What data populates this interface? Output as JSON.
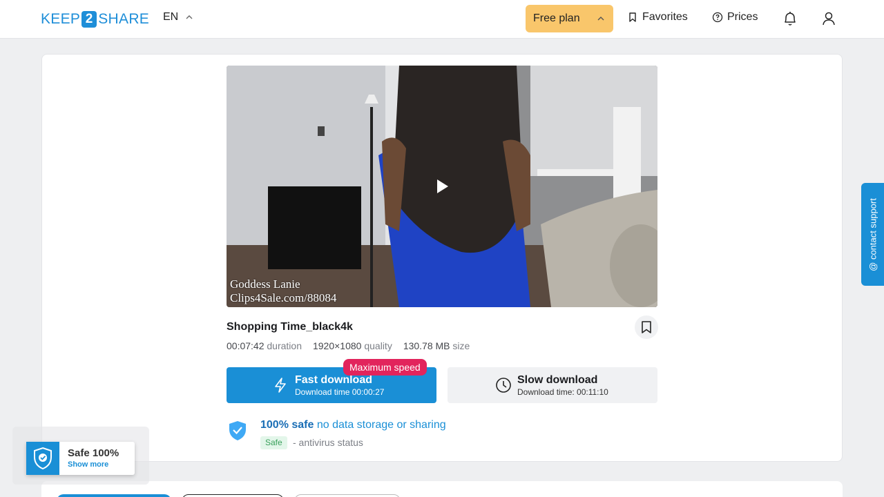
{
  "header": {
    "logo_left": "KEEP",
    "logo_mid": "2",
    "logo_right": "SHARE",
    "language": "EN",
    "plan_label": "Free plan",
    "favorites_label": "Favorites",
    "prices_label": "Prices",
    "icons": [
      "chevron-up-icon",
      "bookmark-icon",
      "question-circle-icon",
      "bell-icon",
      "user-icon"
    ]
  },
  "video": {
    "watermark_line1": "Goddess Lanie",
    "watermark_line2": "Clips4Sale.com/88084"
  },
  "file": {
    "title": "Shopping Time_black4k",
    "duration_value": "00:07:42",
    "duration_label": "duration",
    "quality_value": "1920×1080",
    "quality_label": "quality",
    "size_value": "130.78 MB",
    "size_label": "size"
  },
  "download": {
    "fast_label": "Fast download",
    "fast_time": "Download time 00:00:27",
    "max_badge": "Maximum speed",
    "slow_label": "Slow download",
    "slow_time": "Download time: 00:11:10"
  },
  "safety": {
    "bold": "100% safe",
    "rest": " no data storage or sharing",
    "tag": "Safe",
    "note": "- antivirus status"
  },
  "support": {
    "label": "@ contact support"
  },
  "safe_float": {
    "title": "Safe 100%",
    "link": "Show more"
  },
  "colors": {
    "accent": "#1a8fd6",
    "plan": "#f9c66b",
    "badge": "#e2245c"
  }
}
